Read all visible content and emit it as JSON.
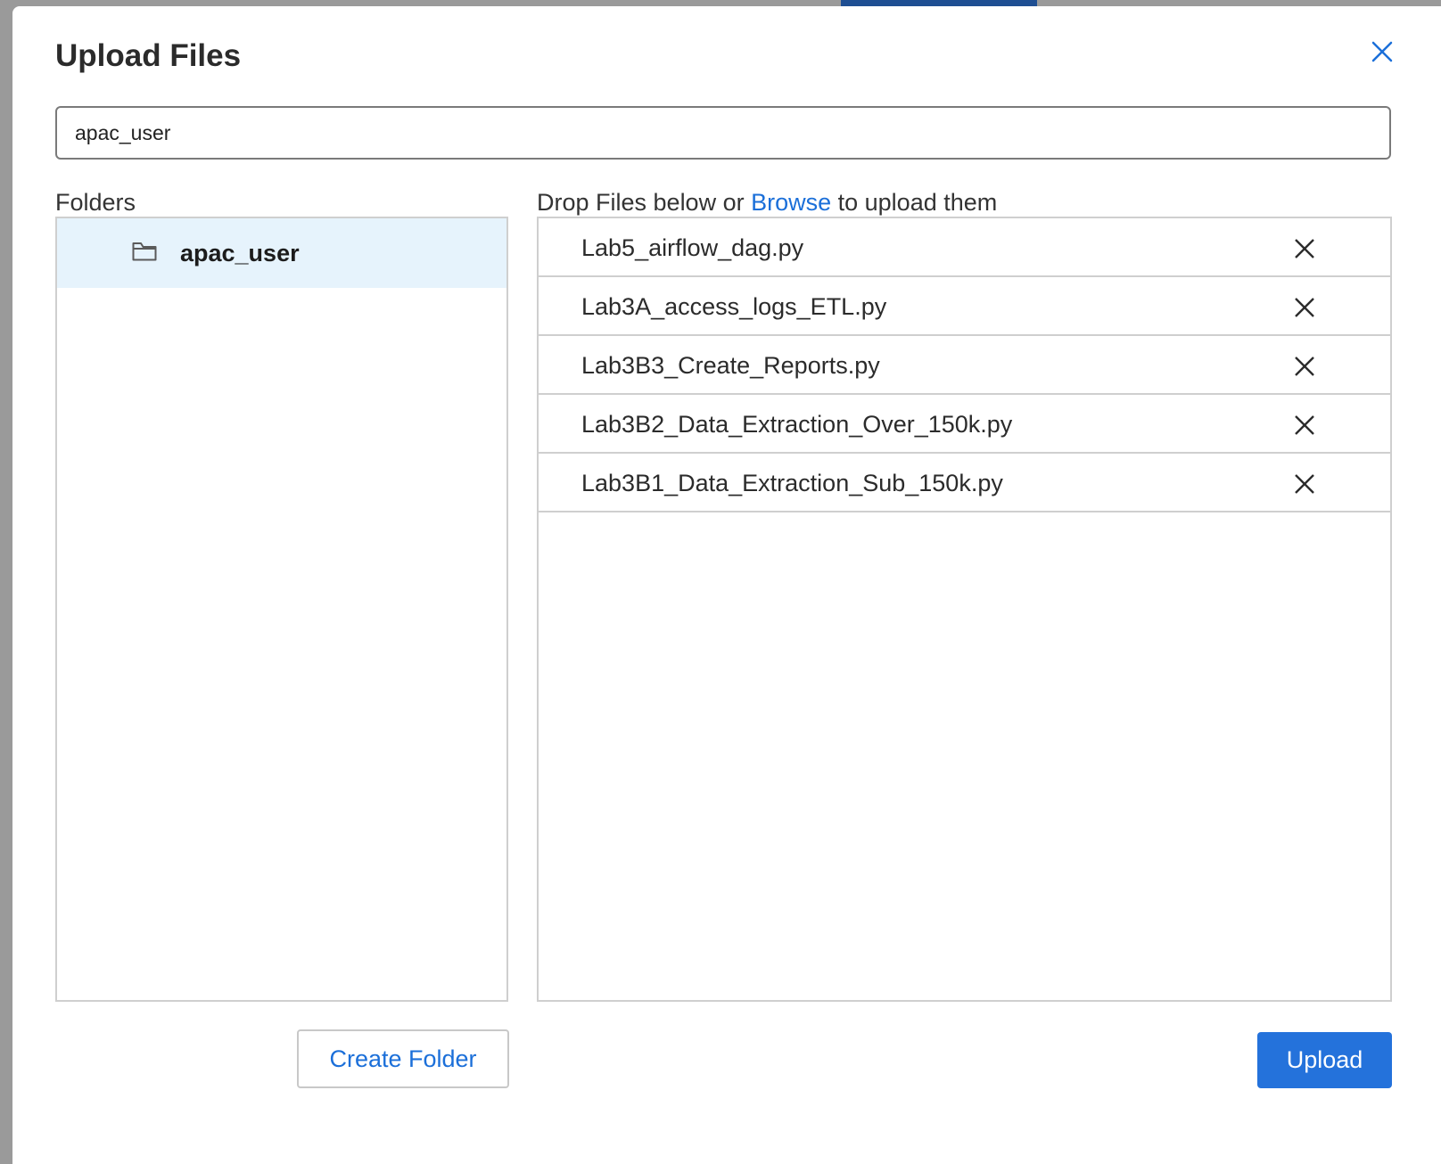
{
  "dialog": {
    "title": "Upload Files",
    "close_icon": "close-icon"
  },
  "path_input": {
    "value": "apac_user"
  },
  "folders": {
    "label": "Folders",
    "items": [
      {
        "name": "apac_user",
        "icon": "folder-icon",
        "selected": true
      }
    ],
    "create_label": "Create Folder"
  },
  "files": {
    "label_prefix": "Drop Files below or ",
    "browse_label": "Browse",
    "label_suffix": " to upload them",
    "items": [
      {
        "name": "Lab5_airflow_dag.py"
      },
      {
        "name": "Lab3A_access_logs_ETL.py"
      },
      {
        "name": "Lab3B3_Create_Reports.py"
      },
      {
        "name": "Lab3B2_Data_Extraction_Over_150k.py"
      },
      {
        "name": "Lab3B1_Data_Extraction_Sub_150k.py"
      }
    ],
    "remove_icon": "remove-icon"
  },
  "actions": {
    "upload_label": "Upload"
  },
  "colors": {
    "accent": "#2472db",
    "link": "#1b6fd9",
    "selected_row": "#e6f3fc",
    "backdrop": "#9a9a9a"
  }
}
